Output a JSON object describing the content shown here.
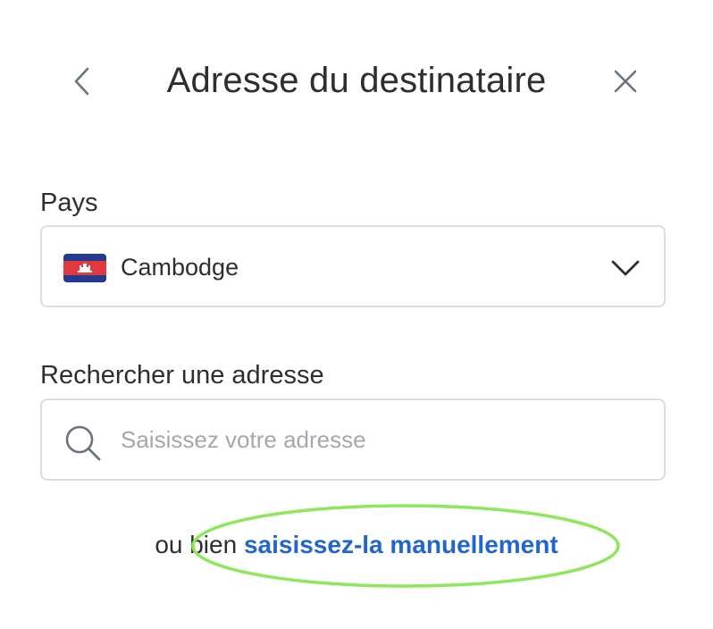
{
  "header": {
    "title": "Adresse du destinataire",
    "back_icon": "chevron-left-icon",
    "close_icon": "close-icon"
  },
  "country": {
    "label": "Pays",
    "selected": "Cambodge",
    "flag_icon": "cambodia-flag-icon",
    "dropdown_icon": "chevron-down-icon"
  },
  "search": {
    "label": "Rechercher une adresse",
    "placeholder": "Saisissez votre adresse",
    "value": "",
    "icon": "search-icon"
  },
  "footer": {
    "prefix": "ou bien ",
    "link_label": "saisissez-la manuellement"
  },
  "colors": {
    "link": "#2266cc",
    "border": "#dcdde0",
    "highlight": "#8ee65a",
    "flag_blue": "#243a8e",
    "flag_red": "#e03a3e"
  }
}
